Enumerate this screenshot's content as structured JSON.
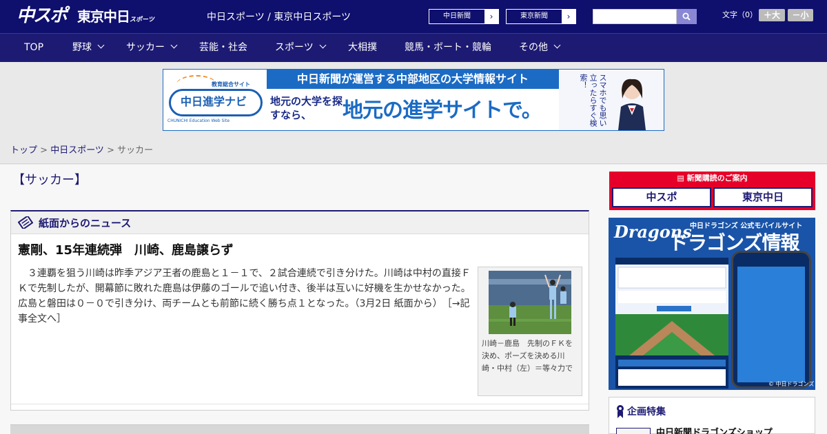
{
  "header": {
    "logo_chuspo": "中スポ",
    "logo_tokyo": "東京中日",
    "logo_tokyo_small": "スポーツ",
    "site_title": "中日スポーツ / 東京中日スポーツ",
    "links": [
      {
        "label": "中日新聞",
        "arrow": "›"
      },
      {
        "label": "東京新聞",
        "arrow": "›"
      }
    ],
    "search_placeholder": "",
    "font_size_label": "文字（0）",
    "font_bigger": "＋大",
    "font_smaller": "－小"
  },
  "nav": {
    "items": [
      {
        "label": "TOP",
        "dropdown": false
      },
      {
        "label": "野球",
        "dropdown": true
      },
      {
        "label": "サッカー",
        "dropdown": true
      },
      {
        "label": "芸能・社会",
        "dropdown": false
      },
      {
        "label": "スポーツ",
        "dropdown": true
      },
      {
        "label": "大相撲",
        "dropdown": false
      },
      {
        "label": "競馬・ボート・競輪",
        "dropdown": false
      },
      {
        "label": "その他",
        "dropdown": true
      }
    ]
  },
  "banner": {
    "kyoiku": "教育総合サイト",
    "badge": "中日進学ナビ",
    "badge_sub": "CHUNICHI Education Web Site",
    "headline": "中日新聞が運営する中部地区の大学情報サイト",
    "sub": "地元の大学を探すなら、",
    "big": "地元の進学サイトで。",
    "vertical": "スマホでも思い立ったらすぐ検索！"
  },
  "breadcrumb": {
    "top": "トップ",
    "sep": " > ",
    "parent": "中日スポーツ",
    "current": "サッカー"
  },
  "page": {
    "heading": "【サッカー】"
  },
  "news": {
    "section_title": "紙面からのニュース",
    "article_title": "憲剛、15年連続弾　川崎、鹿島譲らず",
    "article_body": "３連覇を狙う川崎は昨季アジア王者の鹿島と１－１で、２試合連続で引き分けた。川崎は中村の直接ＦＫで先制したが、開幕節に敗れた鹿島は伊藤のゴールで追い付き、後半は互いに好機を生かせなかった。広島と磐田は０－０で引き分け、両チームとも前節に続く勝ち点１となった。（3月2日 紙面から）",
    "read_more": "［→記事全文へ］",
    "photo_caption": "川崎－鹿島　先制のＦＫを決め、ポーズを決める川崎・中村（左）＝等々力で"
  },
  "sidebar": {
    "subscribe_head": "新聞購読のご案内",
    "subscribe_logo1": "中スポ",
    "subscribe_logo2": "東京中日",
    "dragons_logo": "Dragons",
    "dragons_small": "中日ドラゴンズ 公式モバイルサイト",
    "dragons_big": "ドラゴンズ情報",
    "dragons_copy": "© 中日ドラゴンズ",
    "feature_title": "企画特集",
    "feature_item": "中日新聞ドラゴンズショップ"
  },
  "colors": {
    "header_bg": "#0f0f6e",
    "nav_bg": "#1d1a73",
    "accent": "#1d1a73",
    "subscribe_red": "#e60029",
    "banner_blue": "#1b6bc4"
  }
}
